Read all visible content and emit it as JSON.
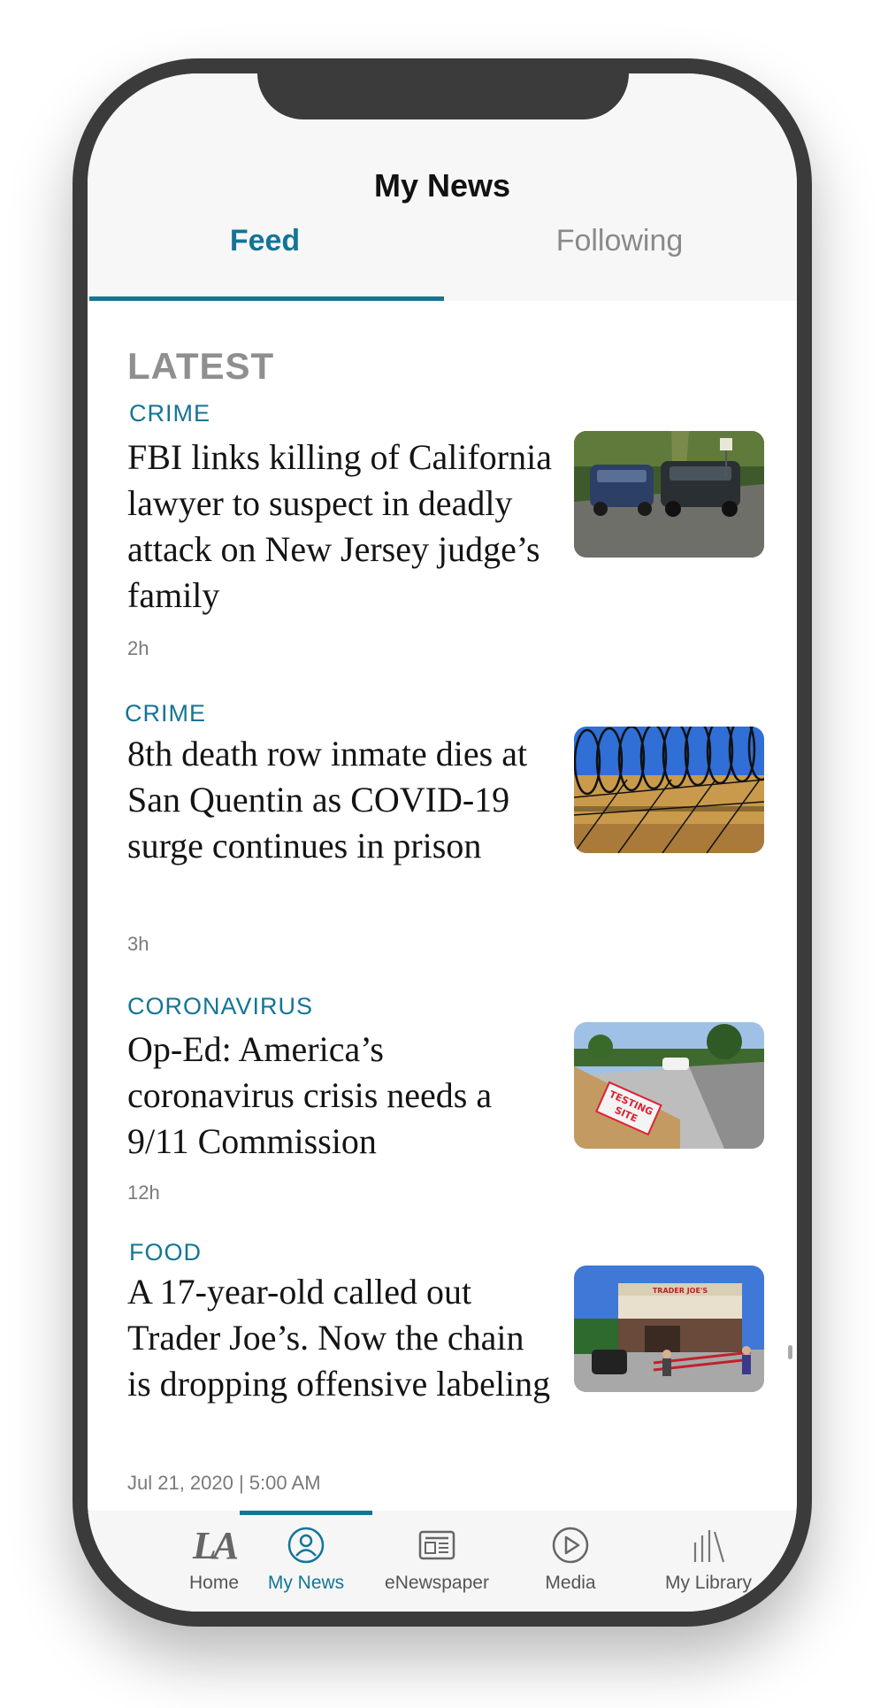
{
  "header": {
    "title": "My News",
    "tabs": [
      {
        "label": "Feed",
        "active": true
      },
      {
        "label": "Following",
        "active": false
      }
    ]
  },
  "feed": {
    "section_title": "LATEST",
    "articles": [
      {
        "category": "CRIME",
        "headline": "FBI links killing of California lawyer to suspect in deadly attack on New Jersey judge’s family",
        "time": "2h",
        "thumbnail": "police-cars-on-road"
      },
      {
        "category": "CRIME",
        "headline": "8th death row inmate dies at San Quentin as COVID-19 surge continues in prison",
        "time": "3h",
        "thumbnail": "razor-wire-prison"
      },
      {
        "category": "CORONAVIRUS",
        "headline": "Op-Ed: America’s coronavirus crisis needs a 9/11 Commission",
        "time": "12h",
        "thumbnail": "testing-site-sign",
        "thumbnail_text": "TESTING SITE"
      },
      {
        "category": "FOOD",
        "headline": "A 17-year-old called out Trader Joe’s. Now the chain is dropping offensive labeling",
        "time": "Jul 21, 2020 | 5:00 AM",
        "thumbnail": "trader-joes-storefront",
        "thumbnail_text": "TRADER JOE'S"
      }
    ]
  },
  "tabbar": {
    "items": [
      {
        "label": "Home",
        "icon": "la-logo-icon",
        "logo_text": "LA",
        "active": false
      },
      {
        "label": "My News",
        "icon": "person-icon",
        "active": true
      },
      {
        "label": "eNewspaper",
        "icon": "newspaper-icon",
        "active": false
      },
      {
        "label": "Media",
        "icon": "play-icon",
        "active": false
      },
      {
        "label": "My Library",
        "icon": "library-icon",
        "active": false
      }
    ]
  },
  "colors": {
    "accent": "#137596",
    "frame": "#3b3b3b",
    "muted_text": "#8a8a8a"
  }
}
